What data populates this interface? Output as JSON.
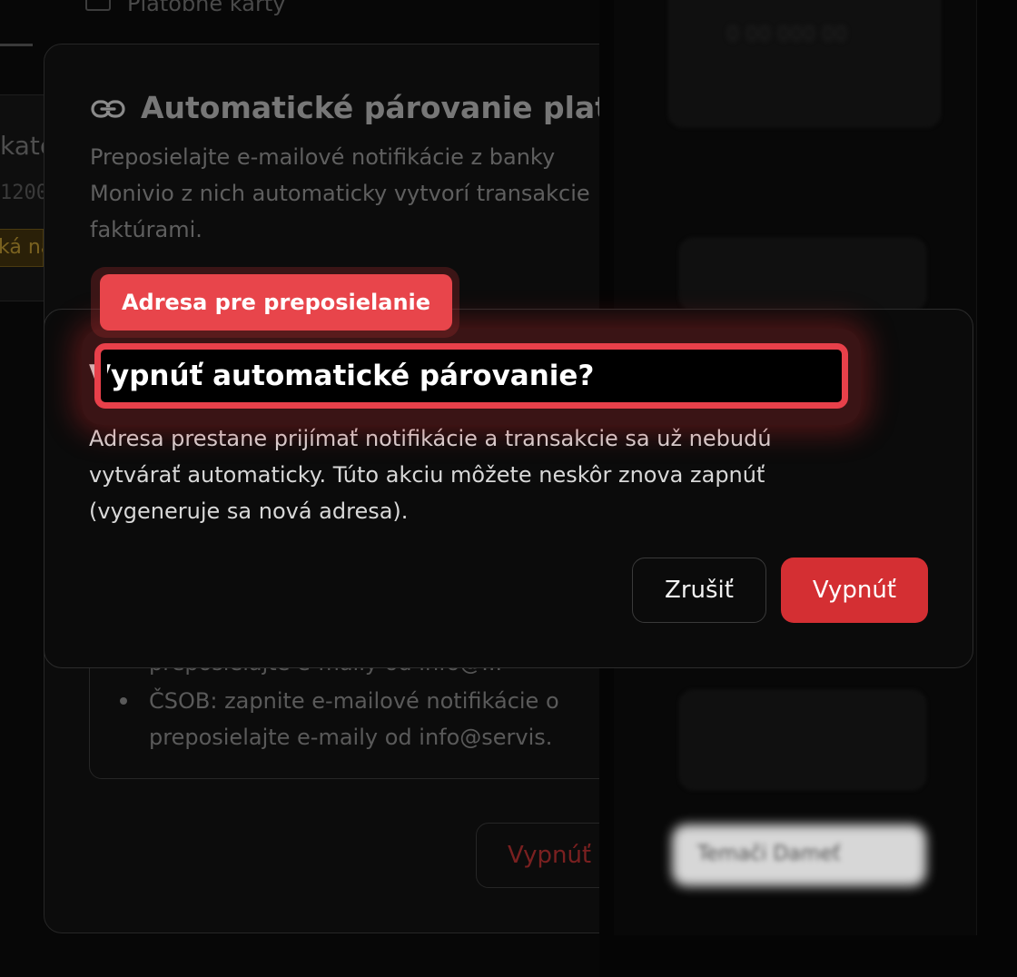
{
  "background": {
    "tab_label": "Platobné karty",
    "left_text_1": "kate",
    "left_text_2": "1200",
    "left_badge": "ká na",
    "card": {
      "title": "Automatické párovanie platieb",
      "description": "Preposielajte e-mailové notifikácie z banky\nMonivio z nich automaticky vytvorí transakcie\nfaktúrami.",
      "instr_line0": "preposielajte e-maily od info@...",
      "instr_bullet": "ČSOB: zapnite e-mailové notifikácie o\npreposielajte e-maily od info@servis.",
      "disable_button": "Vypnúť"
    },
    "right_panel": {
      "button_text": "Temači Dameť"
    }
  },
  "modal": {
    "title": "Vypnúť automatické párovanie?",
    "description": "Adresa prestane prijímať notifikácie a transakcie sa už nebudú\nvytvárať automaticky. Túto akciu môžete neskôr znova zapnúť\n(vygeneruje sa nová adresa).",
    "cancel_label": "Zrušiť",
    "confirm_label": "Vypnúť"
  },
  "highlight": {
    "label": "Adresa pre preposielanie",
    "color": "#e8404a"
  },
  "colors": {
    "confirm": "#d42f33",
    "background": "#070707"
  }
}
